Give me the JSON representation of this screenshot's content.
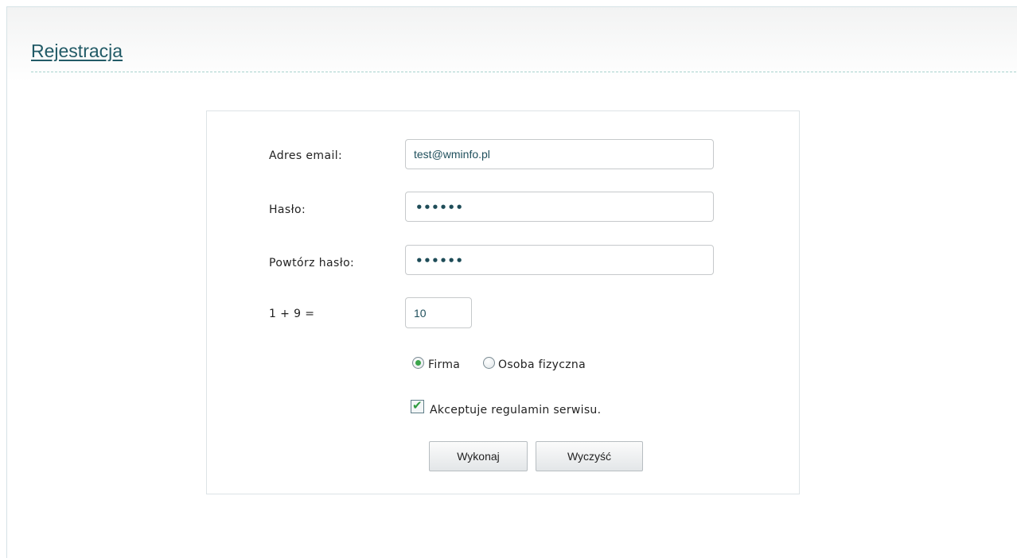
{
  "page": {
    "title": "Rejestracja"
  },
  "form": {
    "email": {
      "label": "Adres email:",
      "value": "test@wminfo.pl"
    },
    "password": {
      "label": "Hasło:",
      "masked_value": "••••••"
    },
    "password_repeat": {
      "label": "Powtórz hasło:",
      "masked_value": "••••••"
    },
    "captcha": {
      "question": "1 + 9 =",
      "value": "10"
    },
    "account_type": {
      "options": [
        {
          "label": "Firma",
          "selected": true
        },
        {
          "label": "Osoba fizyczna",
          "selected": false
        }
      ]
    },
    "terms": {
      "label": "Akceptuje regulamin serwisu.",
      "checked": true
    },
    "buttons": {
      "submit": "Wykonaj",
      "reset": "Wyczyść"
    }
  },
  "colors": {
    "title": "#215a66",
    "divider": "#a9d2cf",
    "input_text": "#1f4f5c",
    "radio_selected": "#3aa44a",
    "checkbox_check": "#2e9b3e"
  }
}
